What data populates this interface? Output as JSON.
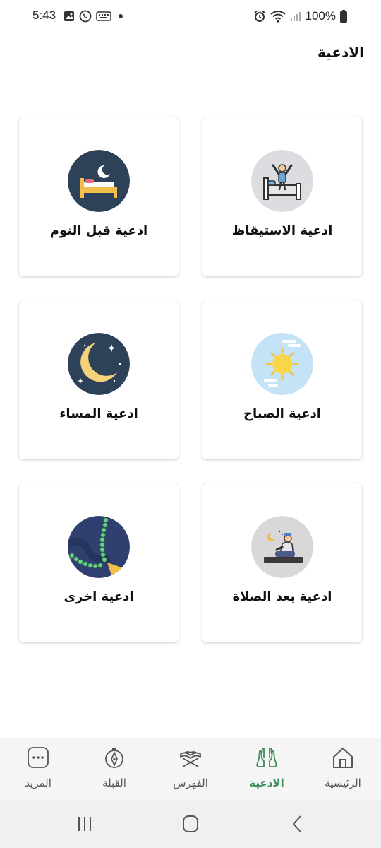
{
  "status_bar": {
    "time": "5:43",
    "battery": "100%"
  },
  "header": {
    "title": "الادعية"
  },
  "cards": [
    {
      "label": "ادعية الاستيقاظ",
      "icon": "waking-up-icon"
    },
    {
      "label": "ادعية قبل النوم",
      "icon": "bed-moon-icon"
    },
    {
      "label": "ادعية الصباح",
      "icon": "sun-icon"
    },
    {
      "label": "ادعية المساء",
      "icon": "crescent-moon-icon"
    },
    {
      "label": "ادعية بعد الصلاة",
      "icon": "praying-man-icon"
    },
    {
      "label": "ادعية اخرى",
      "icon": "prayer-beads-icon"
    }
  ],
  "bottom_nav": {
    "items": [
      {
        "label": "الرئيسية",
        "icon": "home-icon",
        "active": false
      },
      {
        "label": "الادعية",
        "icon": "praying-hands-icon",
        "active": true
      },
      {
        "label": "الفهرس",
        "icon": "quran-stand-icon",
        "active": false
      },
      {
        "label": "القبلة",
        "icon": "compass-icon",
        "active": false
      },
      {
        "label": "المزيد",
        "icon": "more-icon",
        "active": false
      }
    ]
  },
  "colors": {
    "active": "#3d8b5a",
    "card_bg": "#ffffff",
    "nav_bg": "#f5f5f5"
  }
}
